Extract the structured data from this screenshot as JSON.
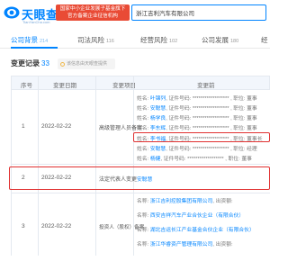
{
  "logo": {
    "text": "天眼查",
    "sub": "TianYanCha.com"
  },
  "promo": {
    "line1": "国家中小企业发展子基金旗下",
    "line2": "官方备案企业征信机构"
  },
  "search": {
    "value": "浙江吉利汽车有限公司"
  },
  "tabs": [
    {
      "label": "公司背景",
      "count": "214"
    },
    {
      "label": "司法风险",
      "count": "116"
    },
    {
      "label": "经营风险",
      "count": "102"
    },
    {
      "label": "公司发展",
      "count": "180"
    },
    {
      "label": "经"
    }
  ],
  "section": {
    "title": "变更记录",
    "count": "33",
    "hint": "该信息由天眼查提供"
  },
  "columns": {
    "seq": "序号",
    "date": "变更日期",
    "item": "变更项目",
    "before": "变更前"
  },
  "rows": [
    {
      "seq": "1",
      "date": "2022-02-22",
      "item": "高级管理人员备案",
      "lines": [
        {
          "pre": "姓名: ",
          "name": "叶锦列",
          "rest": ", 证件号码: ****************** , 职位: 董事"
        },
        {
          "pre": "姓名: ",
          "name": "安聪慧",
          "rest": ", 证件号码: ****************** , 职位: 董事"
        },
        {
          "pre": "姓名: ",
          "name": "杨学良",
          "rest": ", 证件号码: ****************** , 职位: 董事"
        },
        {
          "pre": "姓名: ",
          "name": "李东辉",
          "rest": ", 证件号码: ****************** , 职位: 董事"
        },
        {
          "pre": "姓名: ",
          "name": "李书福",
          "rest": ", 证件号码: ****************** , 职位: 董事长"
        },
        {
          "pre": "姓名: ",
          "name": "安聪慧",
          "rest": ", 证件号码: ****************** , 职位: 经理"
        },
        {
          "pre": "姓名: ",
          "name": "杨健",
          "rest": ", 证件号码: ****************** , 职位: 董事"
        }
      ]
    },
    {
      "seq": "2",
      "date": "2022-02-22",
      "item": "法定代表人变更",
      "lines": [
        {
          "pre": "",
          "name": "安聪慧",
          "rest": ""
        }
      ]
    },
    {
      "seq": "3",
      "date": "2022-02-22",
      "item": "投资人（股权）备案",
      "lines": [
        {
          "pre": "名称: ",
          "name": "浙江吉利控股集团有限公司",
          "rest": ", 出资额:"
        },
        {
          "pre": "名称: ",
          "name": "西安吉祥汽车产业合伙企业（有限合伙）",
          "rest": ""
        },
        {
          "pre": "名称: ",
          "name": "湖北吉运长江产业基金合伙企业（有限合伙）",
          "rest": ""
        },
        {
          "pre": "名称: ",
          "name": "浙江华睿资产管理有限公司",
          "rest": ", 出资额:"
        }
      ]
    }
  ],
  "colors": {
    "brand": "#0084ff",
    "promo": "#e94b35",
    "highlight": "#e03131"
  }
}
